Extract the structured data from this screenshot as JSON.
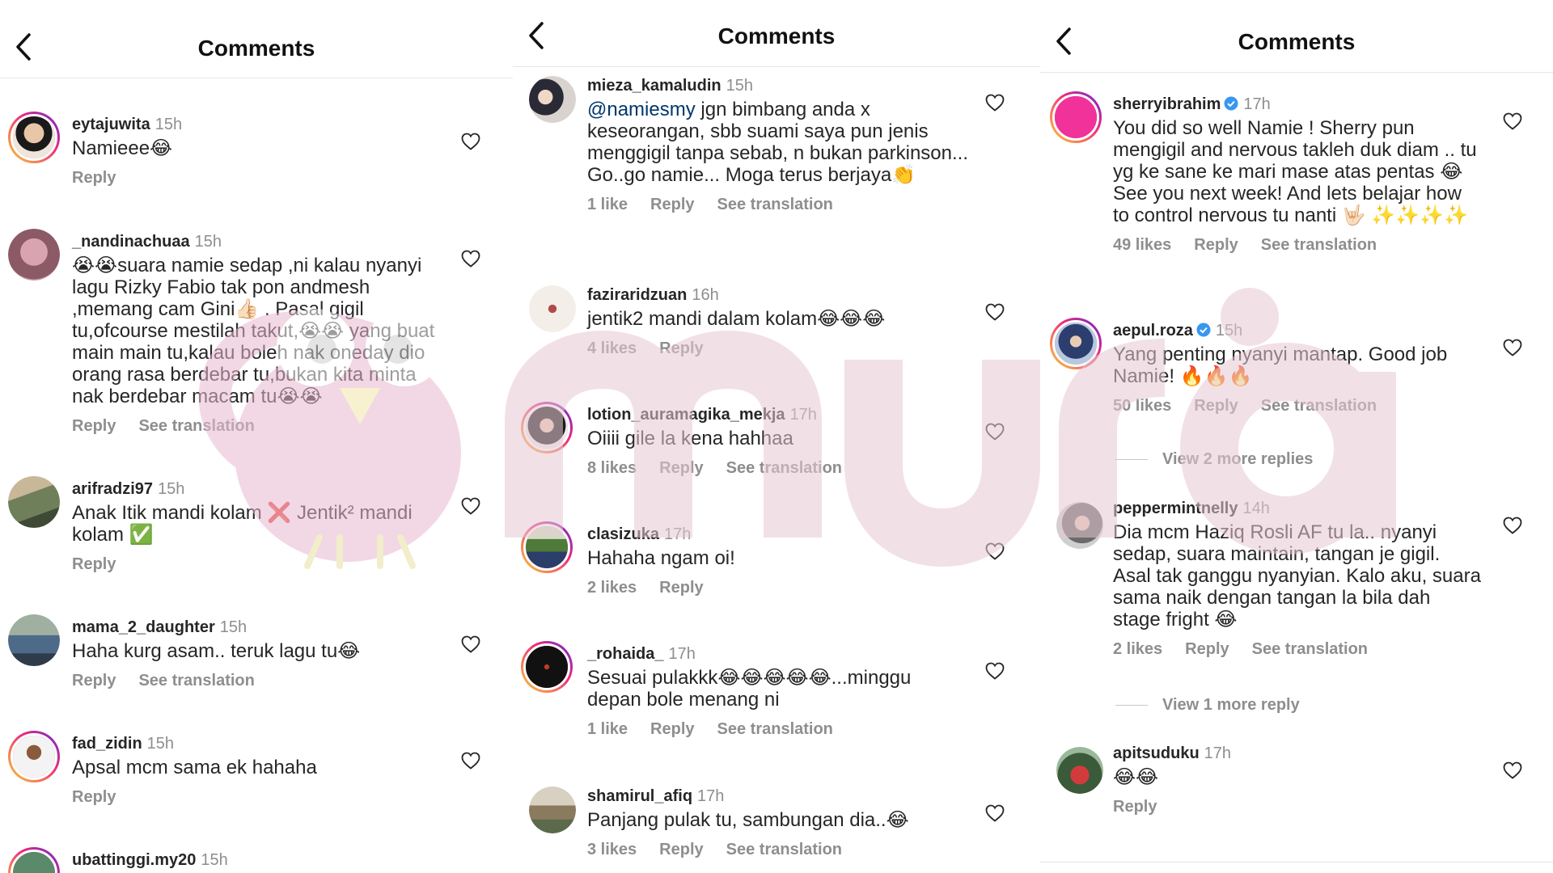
{
  "panels": [
    {
      "title": "Comments",
      "comments": [
        {
          "username": "eytajuwita",
          "time": "15h",
          "text": "Namieee😂",
          "actions": [
            "Reply"
          ]
        },
        {
          "username": "_nandinachuaa",
          "time": "15h",
          "text": "😭😭suara namie sedap ,ni kalau nyanyi lagu Rizky Fabio tak pon andmesh ,memang cam Gini👍🏻 .  Pasal gigil tu,ofcourse mestilah takut,😭😭 yang buat main main tu,kalau boleh nak oneday dio orang rasa berdebar tu,bukan kita minta nak berdebar macam tu😭😭",
          "actions": [
            "Reply",
            "See translation"
          ]
        },
        {
          "username": "arifradzi97",
          "time": "15h",
          "text": "Anak Itik mandi kolam ❌ Jentik² mandi kolam ✅",
          "actions": [
            "Reply"
          ]
        },
        {
          "username": "mama_2_daughter",
          "time": "15h",
          "text": "Haha kurg asam.. teruk lagu tu😂",
          "actions": [
            "Reply",
            "See translation"
          ]
        },
        {
          "username": "fad_zidin",
          "time": "15h",
          "text": "Apsal mcm sama ek hahaha",
          "actions": [
            "Reply"
          ]
        },
        {
          "username": "ubattinggi.my20",
          "time": "15h",
          "text": "",
          "actions": []
        }
      ]
    },
    {
      "title": "Comments",
      "comments": [
        {
          "username": "mieza_kamaludin",
          "time": "15h",
          "mention": "@namiesmy",
          "text": " jgn bimbang anda x keseorangan, sbb suami saya pun jenis menggigil tanpa sebab, n bukan parkinson... Go..go namie... Moga terus berjaya👏",
          "actions": [
            "1 like",
            "Reply",
            "See translation"
          ]
        },
        {
          "username": "faziraridzuan",
          "time": "16h",
          "text": "jentik2 mandi dalam kolam😂😂😂",
          "actions": [
            "4 likes",
            "Reply"
          ]
        },
        {
          "username": "lotion_auramagika_mekja",
          "time": "17h",
          "text": "Oiiii gile la kena hahhaa",
          "actions": [
            "8 likes",
            "Reply",
            "See translation"
          ]
        },
        {
          "username": "clasizuka",
          "time": "17h",
          "text": "Hahaha ngam oi!",
          "actions": [
            "2 likes",
            "Reply"
          ]
        },
        {
          "username": "_rohaida_",
          "time": "17h",
          "text": "Sesuai pulakkk😂😂😂😂😂...minggu depan bole menang ni",
          "actions": [
            "1 like",
            "Reply",
            "See translation"
          ]
        },
        {
          "username": "shamirul_afiq",
          "time": "17h",
          "text": "Panjang pulak tu, sambungan dia..😂",
          "actions": [
            "3 likes",
            "Reply",
            "See translation"
          ]
        }
      ]
    },
    {
      "title": "Comments",
      "comments": [
        {
          "username": "sherryibrahim",
          "verified": true,
          "time": "17h",
          "text": "You did so well Namie ! Sherry pun mengigil and nervous takleh duk diam .. tu yg ke sane ke mari mase atas pentas 😂 See you next week! And lets belajar how to control nervous tu nanti 🤟🏻 ✨✨✨✨",
          "actions": [
            "49 likes",
            "Reply",
            "See translation"
          ]
        },
        {
          "username": "aepul.roza",
          "verified": true,
          "time": "15h",
          "text": "Yang penting nyanyi mantap. Good job Namie! 🔥🔥🔥",
          "actions": [
            "50 likes",
            "Reply",
            "See translation"
          ],
          "view_more": "View 2 more replies"
        },
        {
          "username": "peppermintnelly",
          "time": "14h",
          "text": "Dia mcm Haziq Rosli AF tu la.. nyanyi sedap, suara maintain, tangan je gigil. Asal tak ganggu nyanyian. Kalo aku, suara sama naik dengan tangan la bila dah stage fright 😂",
          "actions": [
            "2 likes",
            "Reply",
            "See translation"
          ],
          "view_more": "View 1 more reply"
        },
        {
          "username": "apitsuduku",
          "time": "17h",
          "text": "😂😂",
          "actions": [
            "Reply"
          ]
        }
      ]
    }
  ],
  "watermark": "murai",
  "colors": {
    "accent_ring_start": "#f9ce34",
    "accent_ring_mid": "#ee2a7b",
    "accent_ring_end": "#6228d7",
    "watermark": "#e7c9d4",
    "verified": "#3897f0",
    "secondary_text": "#8e8e8e"
  }
}
